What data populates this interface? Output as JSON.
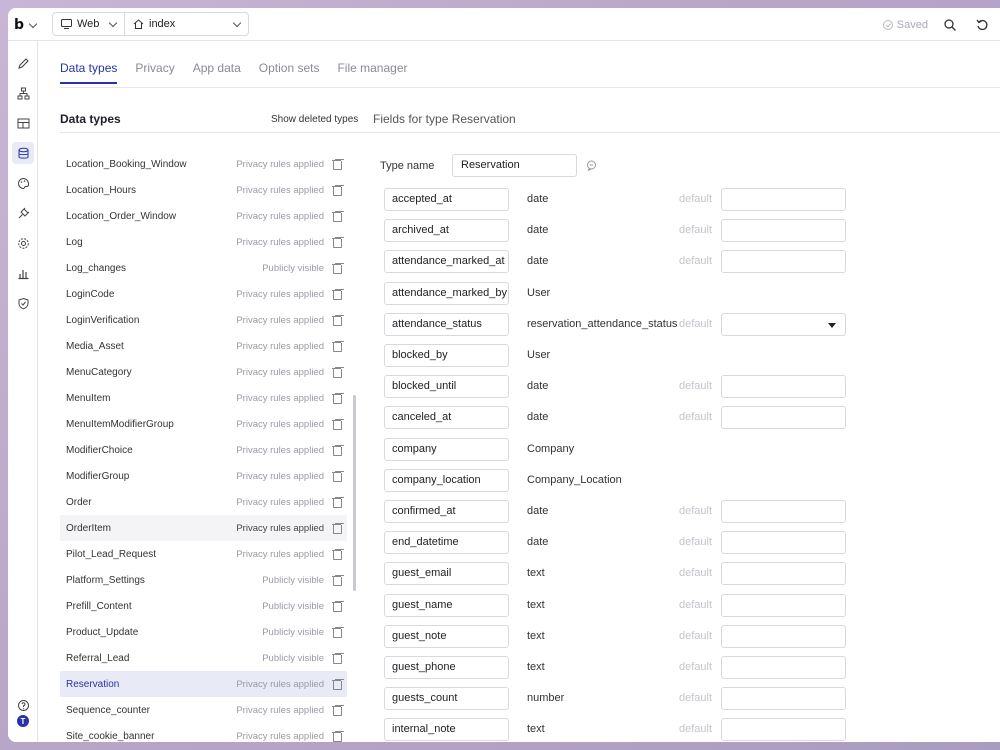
{
  "topbar": {
    "logo": "b",
    "platform": "Web",
    "page": "index",
    "saved_label": "Saved"
  },
  "tabs": [
    "Data types",
    "Privacy",
    "App data",
    "Option sets",
    "File manager"
  ],
  "data_types_header": "Data types",
  "show_deleted": "Show deleted types",
  "fields_title": "Fields for type Reservation",
  "types": [
    {
      "name": "Location_Booking_Window",
      "status": "Privacy rules applied"
    },
    {
      "name": "Location_Hours",
      "status": "Privacy rules applied"
    },
    {
      "name": "Location_Order_Window",
      "status": "Privacy rules applied"
    },
    {
      "name": "Log",
      "status": "Privacy rules applied"
    },
    {
      "name": "Log_changes",
      "status": "Publicly visible"
    },
    {
      "name": "LoginCode",
      "status": "Privacy rules applied"
    },
    {
      "name": "LoginVerification",
      "status": "Privacy rules applied"
    },
    {
      "name": "Media_Asset",
      "status": "Privacy rules applied"
    },
    {
      "name": "MenuCategory",
      "status": "Privacy rules applied"
    },
    {
      "name": "MenuItem",
      "status": "Privacy rules applied"
    },
    {
      "name": "MenuItemModifierGroup",
      "status": "Privacy rules applied"
    },
    {
      "name": "ModifierChoice",
      "status": "Privacy rules applied"
    },
    {
      "name": "ModifierGroup",
      "status": "Privacy rules applied"
    },
    {
      "name": "Order",
      "status": "Privacy rules applied"
    },
    {
      "name": "OrderItem",
      "status": "Privacy rules applied"
    },
    {
      "name": "Pilot_Lead_Request",
      "status": "Privacy rules applied"
    },
    {
      "name": "Platform_Settings",
      "status": "Publicly visible"
    },
    {
      "name": "Prefill_Content",
      "status": "Publicly visible"
    },
    {
      "name": "Product_Update",
      "status": "Publicly visible"
    },
    {
      "name": "Referral_Lead",
      "status": "Publicly visible"
    },
    {
      "name": "Reservation",
      "status": "Privacy rules applied"
    },
    {
      "name": "Sequence_counter",
      "status": "Privacy rules applied"
    },
    {
      "name": "Site_cookie_banner",
      "status": "Privacy rules applied"
    }
  ],
  "type_name_label": "Type name",
  "type_name_value": "Reservation",
  "default_label": "default",
  "fields": [
    {
      "name": "accepted_at",
      "type": "date",
      "default": "box"
    },
    {
      "name": "archived_at",
      "type": "date",
      "default": "box"
    },
    {
      "name": "attendance_marked_at",
      "type": "date",
      "default": "box"
    },
    {
      "name": "attendance_marked_by",
      "type": "User",
      "default": "none"
    },
    {
      "name": "attendance_status",
      "type": "reservation_attendance_status",
      "default": "select"
    },
    {
      "name": "blocked_by",
      "type": "User",
      "default": "none"
    },
    {
      "name": "blocked_until",
      "type": "date",
      "default": "box"
    },
    {
      "name": "canceled_at",
      "type": "date",
      "default": "box"
    },
    {
      "name": "company",
      "type": "Company",
      "default": "none"
    },
    {
      "name": "company_location",
      "type": "Company_Location",
      "default": "none"
    },
    {
      "name": "confirmed_at",
      "type": "date",
      "default": "box"
    },
    {
      "name": "end_datetime",
      "type": "date",
      "default": "box"
    },
    {
      "name": "guest_email",
      "type": "text",
      "default": "box"
    },
    {
      "name": "guest_name",
      "type": "text",
      "default": "box"
    },
    {
      "name": "guest_note",
      "type": "text",
      "default": "box"
    },
    {
      "name": "guest_phone",
      "type": "text",
      "default": "box"
    },
    {
      "name": "guests_count",
      "type": "number",
      "default": "box"
    },
    {
      "name": "internal_note",
      "type": "text",
      "default": "box"
    }
  ],
  "avatar_initial": "T",
  "colors": {
    "accent": "#2733a6",
    "selected_bg": "#e8eaf6"
  }
}
